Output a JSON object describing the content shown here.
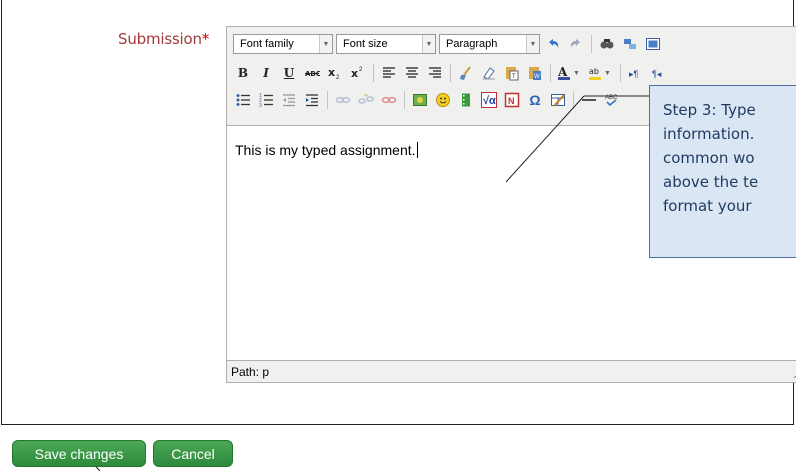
{
  "form": {
    "submission_label": "Submission",
    "required_marker": "*"
  },
  "editor": {
    "font_family": "Font family",
    "font_size": "Font size",
    "paragraph": "Paragraph",
    "content": "This is my typed assignment.",
    "path": "Path: p",
    "toolbar_icons": [
      "undo-icon",
      "redo-icon",
      "find-icon",
      "find-replace-icon",
      "fullscreen-icon",
      "bold-icon",
      "italic-icon",
      "underline-icon",
      "strikethrough-icon",
      "subscript-icon",
      "superscript-icon",
      "align-left-icon",
      "align-center-icon",
      "align-right-icon",
      "cleanup-icon",
      "remove-format-icon",
      "paste-text-icon",
      "paste-word-icon",
      "text-color-icon",
      "highlight-color-icon",
      "ltr-icon",
      "rtl-icon",
      "unordered-list-icon",
      "ordered-list-icon",
      "outdent-icon",
      "indent-icon",
      "link-icon",
      "unlink-icon",
      "anchor-icon",
      "image-icon",
      "emoticon-icon",
      "media-icon",
      "equation-icon",
      "nonbreaking-icon",
      "special-char-icon",
      "table-icon",
      "hr-icon",
      "spellcheck-icon"
    ],
    "colors": {
      "toolbar_bg": "#f0f0ee",
      "border": "#b0b0b0"
    }
  },
  "callout": {
    "lines": [
      "Step 3: Type",
      "information.",
      "common wo",
      "above the te",
      "format your"
    ],
    "colors": {
      "bg": "#dbe6f4",
      "border": "#4f6f9f"
    }
  },
  "actions": {
    "save_label": "Save changes",
    "cancel_label": "Cancel",
    "color": "#2c8a3a"
  },
  "label_color": "#a33a3a"
}
